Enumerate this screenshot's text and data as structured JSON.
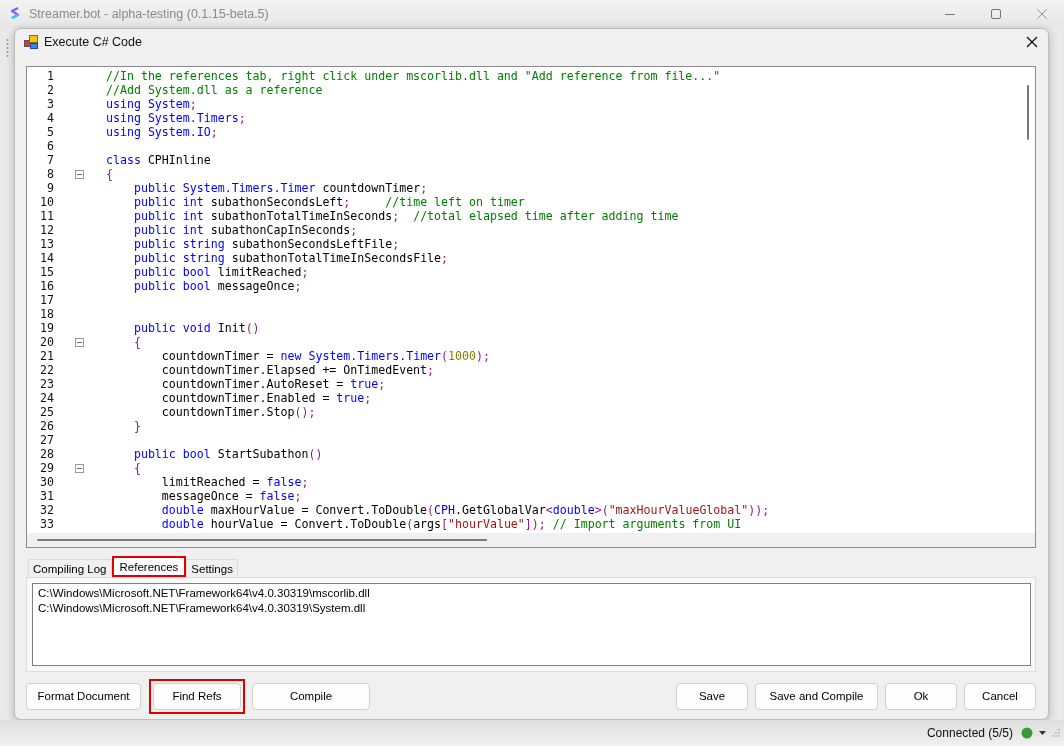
{
  "app_window": {
    "title": "Streamer.bot - alpha-testing (0.1.15-beta.5)"
  },
  "dialog": {
    "title": "Execute C# Code"
  },
  "editor": {
    "lines": [
      {
        "number": "1",
        "fold": false,
        "tokens": [
          {
            "kind": "comment",
            "text": "//In the references tab, right click under mscorlib.dll and \"Add reference from file...\""
          }
        ]
      },
      {
        "number": "2",
        "fold": false,
        "tokens": [
          {
            "kind": "comment",
            "text": "//Add System.dll as a reference"
          }
        ]
      },
      {
        "number": "3",
        "fold": false,
        "tokens": [
          {
            "kind": "kw",
            "text": "using"
          },
          {
            "kind": "kw",
            "text": " System"
          },
          {
            "kind": "punct",
            "text": ";"
          }
        ]
      },
      {
        "number": "4",
        "fold": false,
        "tokens": [
          {
            "kind": "kw",
            "text": "using"
          },
          {
            "kind": "kw",
            "text": " System.Timers"
          },
          {
            "kind": "punct",
            "text": ";"
          }
        ]
      },
      {
        "number": "5",
        "fold": false,
        "tokens": [
          {
            "kind": "kw",
            "text": "using"
          },
          {
            "kind": "kw",
            "text": " System.IO"
          },
          {
            "kind": "punct",
            "text": ";"
          }
        ]
      },
      {
        "number": "6",
        "fold": false
      },
      {
        "number": "7",
        "fold": false,
        "tokens": [
          {
            "kind": "kw",
            "text": "class"
          },
          {
            "kind": "plain",
            "text": " CPHInline"
          }
        ]
      },
      {
        "number": "8",
        "fold": true,
        "tokens": [
          {
            "kind": "punct",
            "text": "{"
          }
        ]
      },
      {
        "number": "9",
        "fold": false,
        "tokens": [
          {
            "kind": "kw",
            "text": "    public"
          },
          {
            "kind": "kw",
            "text": " System.Timers.Timer"
          },
          {
            "kind": "plain",
            "text": " countdownTimer"
          },
          {
            "kind": "punct",
            "text": ";"
          }
        ]
      },
      {
        "number": "10",
        "fold": false,
        "tokens": [
          {
            "kind": "kw",
            "text": "    public"
          },
          {
            "kind": "kw",
            "text": " int"
          },
          {
            "kind": "plain",
            "text": " subathonSecondsLeft"
          },
          {
            "kind": "punct",
            "text": ";"
          },
          {
            "kind": "comment",
            "text": "     //time left on timer"
          }
        ]
      },
      {
        "number": "11",
        "fold": false,
        "tokens": [
          {
            "kind": "kw",
            "text": "    public"
          },
          {
            "kind": "kw",
            "text": " int"
          },
          {
            "kind": "plain",
            "text": " subathonTotalTimeInSeconds"
          },
          {
            "kind": "punct",
            "text": ";"
          },
          {
            "kind": "comment",
            "text": "  //total elapsed time after adding time"
          }
        ]
      },
      {
        "number": "12",
        "fold": false,
        "tokens": [
          {
            "kind": "kw",
            "text": "    public"
          },
          {
            "kind": "kw",
            "text": " int"
          },
          {
            "kind": "plain",
            "text": " subathonCapInSeconds"
          },
          {
            "kind": "punct",
            "text": ";"
          }
        ]
      },
      {
        "number": "13",
        "fold": false,
        "tokens": [
          {
            "kind": "kw",
            "text": "    public"
          },
          {
            "kind": "kw",
            "text": " string"
          },
          {
            "kind": "plain",
            "text": " subathonSecondsLeftFile"
          },
          {
            "kind": "punct",
            "text": ";"
          }
        ]
      },
      {
        "number": "14",
        "fold": false,
        "tokens": [
          {
            "kind": "kw",
            "text": "    public"
          },
          {
            "kind": "kw",
            "text": " string"
          },
          {
            "kind": "plain",
            "text": " subathonTotalTimeInSecondsFile"
          },
          {
            "kind": "punct",
            "text": ";"
          }
        ]
      },
      {
        "number": "15",
        "fold": false,
        "tokens": [
          {
            "kind": "kw",
            "text": "    public"
          },
          {
            "kind": "kw",
            "text": " bool"
          },
          {
            "kind": "plain",
            "text": " limitReached"
          },
          {
            "kind": "punct",
            "text": ";"
          }
        ]
      },
      {
        "number": "16",
        "fold": false,
        "tokens": [
          {
            "kind": "kw",
            "text": "    public"
          },
          {
            "kind": "kw",
            "text": " bool"
          },
          {
            "kind": "plain",
            "text": " messageOnce"
          },
          {
            "kind": "punct",
            "text": ";"
          }
        ]
      },
      {
        "number": "17",
        "fold": false
      },
      {
        "number": "18",
        "fold": false
      },
      {
        "number": "19",
        "fold": false,
        "tokens": [
          {
            "kind": "kw",
            "text": "    public"
          },
          {
            "kind": "kw",
            "text": " void"
          },
          {
            "kind": "plain",
            "text": " Init"
          },
          {
            "kind": "punct",
            "text": "()"
          }
        ]
      },
      {
        "number": "20",
        "fold": true,
        "tokens": [
          {
            "kind": "punct",
            "text": "    {"
          }
        ]
      },
      {
        "number": "21",
        "fold": false,
        "tokens": [
          {
            "kind": "plain",
            "text": "        countdownTimer = "
          },
          {
            "kind": "kw",
            "text": "new"
          },
          {
            "kind": "kw",
            "text": " System.Timers.Timer"
          },
          {
            "kind": "punct",
            "text": "("
          },
          {
            "kind": "number",
            "text": "1000"
          },
          {
            "kind": "punct",
            "text": ");"
          }
        ]
      },
      {
        "number": "22",
        "fold": false,
        "tokens": [
          {
            "kind": "plain",
            "text": "        countdownTimer.Elapsed += OnTimedEvent"
          },
          {
            "kind": "punct",
            "text": ";"
          }
        ]
      },
      {
        "number": "23",
        "fold": false,
        "tokens": [
          {
            "kind": "plain",
            "text": "        countdownTimer.AutoReset = "
          },
          {
            "kind": "kw",
            "text": "true"
          },
          {
            "kind": "punct",
            "text": ";"
          }
        ]
      },
      {
        "number": "24",
        "fold": false,
        "tokens": [
          {
            "kind": "plain",
            "text": "        countdownTimer.Enabled = "
          },
          {
            "kind": "kw",
            "text": "true"
          },
          {
            "kind": "punct",
            "text": ";"
          }
        ]
      },
      {
        "number": "25",
        "fold": false,
        "tokens": [
          {
            "kind": "plain",
            "text": "        countdownTimer.Stop"
          },
          {
            "kind": "punct",
            "text": "();"
          }
        ]
      },
      {
        "number": "26",
        "fold": false,
        "tokens": [
          {
            "kind": "punct",
            "text": "    }"
          }
        ]
      },
      {
        "number": "27",
        "fold": false
      },
      {
        "number": "28",
        "fold": false,
        "tokens": [
          {
            "kind": "kw",
            "text": "    public"
          },
          {
            "kind": "kw",
            "text": " bool"
          },
          {
            "kind": "plain",
            "text": " StartSubathon"
          },
          {
            "kind": "punct",
            "text": "()"
          }
        ]
      },
      {
        "number": "29",
        "fold": true,
        "tokens": [
          {
            "kind": "punct",
            "text": "    {"
          }
        ]
      },
      {
        "number": "30",
        "fold": false,
        "tokens": [
          {
            "kind": "plain",
            "text": "        limitReached = "
          },
          {
            "kind": "kw",
            "text": "false"
          },
          {
            "kind": "punct",
            "text": ";"
          }
        ]
      },
      {
        "number": "31",
        "fold": false,
        "tokens": [
          {
            "kind": "plain",
            "text": "        messageOnce = "
          },
          {
            "kind": "kw",
            "text": "false"
          },
          {
            "kind": "punct",
            "text": ";"
          }
        ]
      },
      {
        "number": "32",
        "fold": false,
        "tokens": [
          {
            "kind": "kw",
            "text": "        double"
          },
          {
            "kind": "plain",
            "text": " maxHourValue = Convert.ToDouble"
          },
          {
            "kind": "punct",
            "text": "("
          },
          {
            "kind": "kw",
            "text": "CPH"
          },
          {
            "kind": "plain",
            "text": ".GetGlobalVar"
          },
          {
            "kind": "punct",
            "text": "<"
          },
          {
            "kind": "kw",
            "text": "double"
          },
          {
            "kind": "punct",
            "text": ">("
          },
          {
            "kind": "string",
            "text": "\"maxHourValueGlobal\""
          },
          {
            "kind": "punct",
            "text": "));"
          }
        ]
      },
      {
        "number": "33",
        "fold": false,
        "tokens": [
          {
            "kind": "kw",
            "text": "        double"
          },
          {
            "kind": "plain",
            "text": " hourValue = Convert.ToDouble"
          },
          {
            "kind": "punct",
            "text": "("
          },
          {
            "kind": "plain",
            "text": "args"
          },
          {
            "kind": "punct",
            "text": "["
          },
          {
            "kind": "string",
            "text": "\"hourValue\""
          },
          {
            "kind": "punct",
            "text": "]);"
          },
          {
            "kind": "comment",
            "text": " // Import arguments from UI"
          }
        ]
      }
    ]
  },
  "tabs": [
    {
      "label": "Compiling Log",
      "selected": false,
      "highlighted": false
    },
    {
      "label": "References",
      "selected": true,
      "highlighted": true
    },
    {
      "label": "Settings",
      "selected": false,
      "highlighted": false
    }
  ],
  "references": [
    "C:\\Windows\\Microsoft.NET\\Framework64\\v4.0.30319\\mscorlib.dll",
    "C:\\Windows\\Microsoft.NET\\Framework64\\v4.0.30319\\System.dll"
  ],
  "buttons_left": [
    {
      "label": "Format Document",
      "highlighted": false
    },
    {
      "label": "Find Refs",
      "highlighted": true
    },
    {
      "label": "Compile",
      "highlighted": false
    }
  ],
  "buttons_right": [
    {
      "label": "Save",
      "highlighted": false
    },
    {
      "label": "Save and Compile",
      "highlighted": false
    },
    {
      "label": "Ok",
      "highlighted": false
    },
    {
      "label": "Cancel",
      "highlighted": false
    }
  ],
  "status_bar": {
    "text": "Connected (5/5)"
  }
}
